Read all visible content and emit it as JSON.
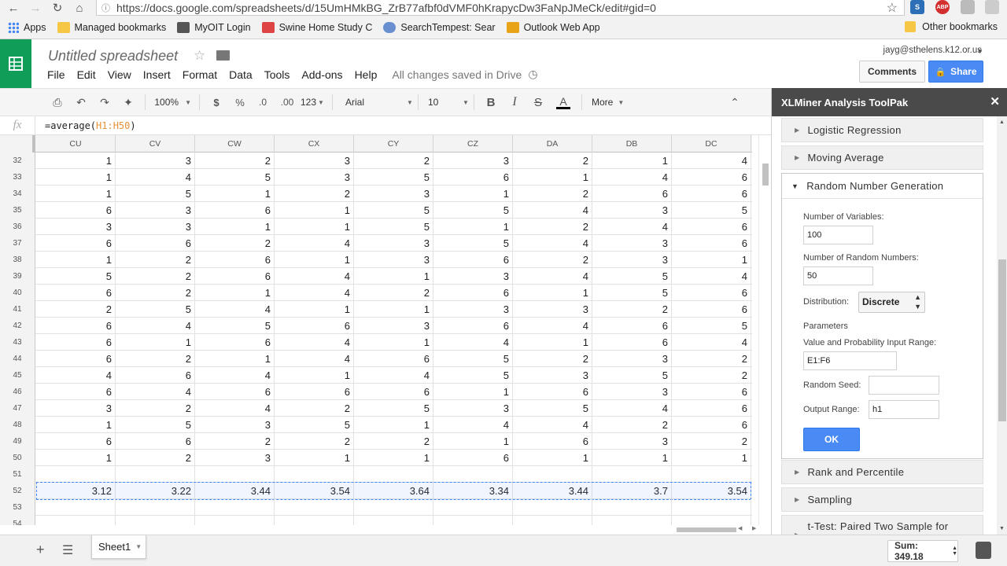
{
  "browser": {
    "url": "https://docs.google.com/spreadsheets/d/15UmHMkBG_ZrB77afbf0dVMF0hKrapycDw3FaNpJMeCk/edit#gid=0",
    "ext_s": "S",
    "ext_abp": "ABP"
  },
  "bookmarks": {
    "items": [
      "Apps",
      "Managed bookmarks",
      "MyOIT Login",
      "Swine Home Study C",
      "SearchTempest: Sear",
      "Outlook Web App"
    ],
    "other": "Other bookmarks"
  },
  "sheets": {
    "title": "Untitled spreadsheet",
    "menu": [
      "File",
      "Edit",
      "View",
      "Insert",
      "Format",
      "Data",
      "Tools",
      "Add-ons",
      "Help"
    ],
    "saved_status": "All changes saved in Drive",
    "account": "jayg@sthelens.k12.or.us",
    "comments_label": "Comments",
    "share_label": "Share"
  },
  "toolbar": {
    "zoom": "100%",
    "currency": "$",
    "percent": "%",
    "dec_less": ".0",
    "dec_more": ".00",
    "format": "123",
    "font": "Arial",
    "size": "10",
    "bold": "B",
    "italic": "I",
    "strike": "S",
    "textcolor": "A",
    "more": "More"
  },
  "formula": {
    "fx": "fx",
    "prefix": "=average(",
    "ref": "H1:H50",
    "suffix": ")"
  },
  "grid": {
    "columns": [
      "CU",
      "CV",
      "CW",
      "CX",
      "CY",
      "CZ",
      "DA",
      "DB",
      "DC"
    ],
    "rows": [
      {
        "n": "32",
        "v": [
          "1",
          "3",
          "2",
          "3",
          "2",
          "3",
          "2",
          "1",
          "4"
        ]
      },
      {
        "n": "33",
        "v": [
          "1",
          "4",
          "5",
          "3",
          "5",
          "6",
          "1",
          "4",
          "6"
        ]
      },
      {
        "n": "34",
        "v": [
          "1",
          "5",
          "1",
          "2",
          "3",
          "1",
          "2",
          "6",
          "6"
        ]
      },
      {
        "n": "35",
        "v": [
          "6",
          "3",
          "6",
          "1",
          "5",
          "5",
          "4",
          "3",
          "5"
        ]
      },
      {
        "n": "36",
        "v": [
          "3",
          "3",
          "1",
          "1",
          "5",
          "1",
          "2",
          "4",
          "6"
        ]
      },
      {
        "n": "37",
        "v": [
          "6",
          "6",
          "2",
          "4",
          "3",
          "5",
          "4",
          "3",
          "6"
        ]
      },
      {
        "n": "38",
        "v": [
          "1",
          "2",
          "6",
          "1",
          "3",
          "6",
          "2",
          "3",
          "1"
        ]
      },
      {
        "n": "39",
        "v": [
          "5",
          "2",
          "6",
          "4",
          "1",
          "3",
          "4",
          "5",
          "4"
        ]
      },
      {
        "n": "40",
        "v": [
          "6",
          "2",
          "1",
          "4",
          "2",
          "6",
          "1",
          "5",
          "6"
        ]
      },
      {
        "n": "41",
        "v": [
          "2",
          "5",
          "4",
          "1",
          "1",
          "3",
          "3",
          "2",
          "6"
        ]
      },
      {
        "n": "42",
        "v": [
          "6",
          "4",
          "5",
          "6",
          "3",
          "6",
          "4",
          "6",
          "5"
        ]
      },
      {
        "n": "43",
        "v": [
          "6",
          "1",
          "6",
          "4",
          "1",
          "4",
          "1",
          "6",
          "4"
        ]
      },
      {
        "n": "44",
        "v": [
          "6",
          "2",
          "1",
          "4",
          "6",
          "5",
          "2",
          "3",
          "2"
        ]
      },
      {
        "n": "45",
        "v": [
          "4",
          "6",
          "4",
          "1",
          "4",
          "5",
          "3",
          "5",
          "2"
        ]
      },
      {
        "n": "46",
        "v": [
          "6",
          "4",
          "6",
          "6",
          "6",
          "1",
          "6",
          "3",
          "6"
        ]
      },
      {
        "n": "47",
        "v": [
          "3",
          "2",
          "4",
          "2",
          "5",
          "3",
          "5",
          "4",
          "6"
        ]
      },
      {
        "n": "48",
        "v": [
          "1",
          "5",
          "3",
          "5",
          "1",
          "4",
          "4",
          "2",
          "6"
        ]
      },
      {
        "n": "49",
        "v": [
          "6",
          "6",
          "2",
          "2",
          "2",
          "1",
          "6",
          "3",
          "2"
        ]
      },
      {
        "n": "50",
        "v": [
          "1",
          "2",
          "3",
          "1",
          "1",
          "6",
          "1",
          "1",
          "1"
        ]
      },
      {
        "n": "51",
        "v": [
          "",
          "",
          "",
          "",
          "",
          "",
          "",
          "",
          ""
        ]
      },
      {
        "n": "52",
        "v": [
          "3.12",
          "3.22",
          "3.44",
          "3.54",
          "3.64",
          "3.34",
          "3.44",
          "3.7",
          "3.54"
        ]
      },
      {
        "n": "53",
        "v": [
          "",
          "",
          "",
          "",
          "",
          "",
          "",
          "",
          ""
        ]
      },
      {
        "n": "54",
        "v": [
          "",
          "",
          "",
          "",
          "",
          "",
          "",
          "",
          ""
        ]
      }
    ]
  },
  "sheetbar": {
    "tab": "Sheet1",
    "sum": "Sum: 349.18"
  },
  "sidebar": {
    "title": "XLMiner Analysis ToolPak",
    "sections_top": [
      "Logistic Regression",
      "Moving Average"
    ],
    "open_section": "Random Number Generation",
    "fields": {
      "num_vars_label": "Number of Variables:",
      "num_vars_value": "100",
      "num_rand_label": "Number of Random Numbers:",
      "num_rand_value": "50",
      "dist_label": "Distribution:",
      "dist_value": "Discrete",
      "params_label": "Parameters",
      "range_label": "Value and Probability Input Range:",
      "range_value": "E1:F6",
      "seed_label": "Random Seed:",
      "seed_value": "",
      "output_label": "Output Range:",
      "output_value": "h1"
    },
    "ok_label": "OK",
    "sections_bottom": [
      "Rank and Percentile",
      "Sampling",
      "t-Test: Paired Two Sample for"
    ]
  },
  "colors": {
    "sheets_green": "#0f9d58",
    "share_blue": "#4a8af4",
    "sidebar_header": "#4a4a4a",
    "formula_ref": "#e69138"
  }
}
